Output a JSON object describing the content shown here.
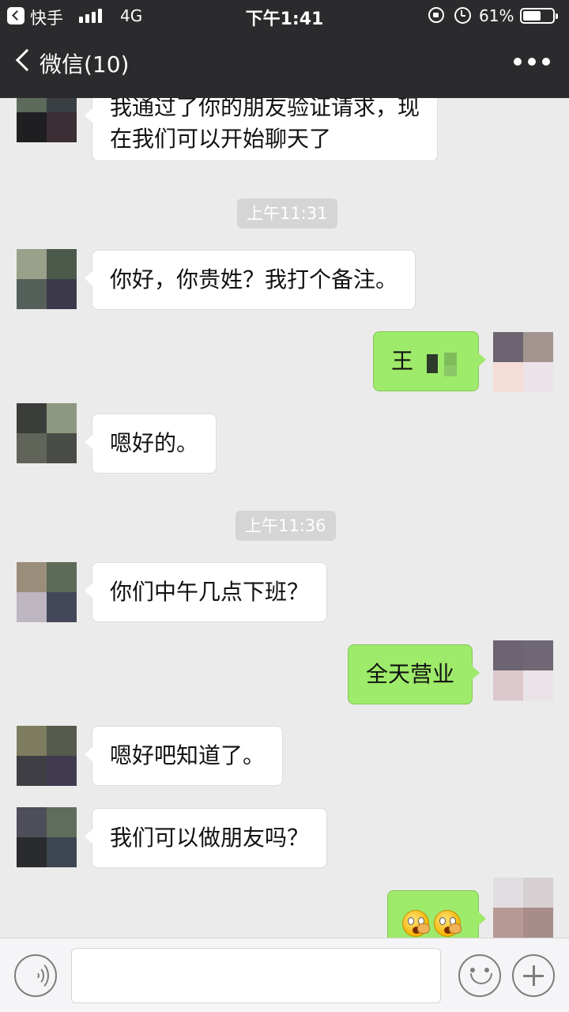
{
  "status_bar": {
    "back_app": "快手",
    "network": "4G",
    "time": "下午1:41",
    "battery_text": "61%",
    "battery_level": 0.61,
    "signal_bars": 4,
    "icons": [
      "back-to-app-icon",
      "signal-icon",
      "rotation-lock-icon",
      "alarm-icon",
      "battery-icon"
    ]
  },
  "nav": {
    "back_label": "微信(10)",
    "chat_name": "",
    "more_icon": "more-dots-icon"
  },
  "messages": [
    {
      "type": "incoming",
      "lines": [
        "我通过了你的朋友验证请求，现",
        "在我们可以开始聊天了"
      ]
    },
    {
      "type": "time",
      "text": "上午11:31"
    },
    {
      "type": "incoming",
      "lines": [
        "你好，你贵姓？我打个备注。"
      ]
    },
    {
      "type": "outgoing",
      "lines": [
        "王"
      ],
      "note": "rest of name obscured"
    },
    {
      "type": "incoming",
      "lines": [
        "嗯好的。"
      ]
    },
    {
      "type": "time",
      "text": "上午11:36"
    },
    {
      "type": "incoming",
      "lines": [
        "你们中午几点下班？"
      ]
    },
    {
      "type": "outgoing",
      "lines": [
        "全天营业"
      ]
    },
    {
      "type": "incoming",
      "lines": [
        "嗯好吧知道了。"
      ]
    },
    {
      "type": "incoming",
      "lines": [
        "我们可以做朋友吗？"
      ]
    },
    {
      "type": "outgoing",
      "lines": [],
      "emoji": [
        "surprised-face-emoji",
        "surprised-face-emoji"
      ]
    }
  ],
  "input_bar": {
    "voice_icon": "voice-icon",
    "input_value": "",
    "emoji_icon": "emoji-icon",
    "plus_icon": "plus-icon"
  },
  "colors": {
    "nav_bg": "#2b2b2d",
    "chat_bg": "#ebebeb",
    "bubble_in": "#ffffff",
    "bubble_out": "#9eea6a",
    "time_pill": "#d5d5d5"
  }
}
